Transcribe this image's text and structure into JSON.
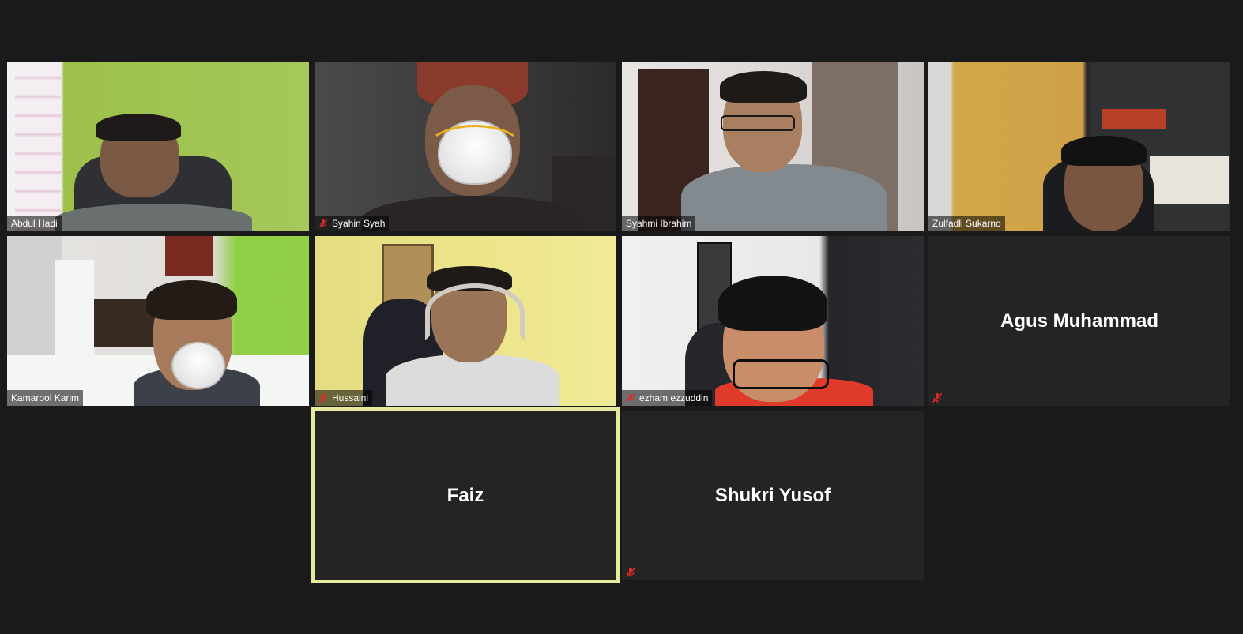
{
  "participants": [
    {
      "name": "Abdul Hadi",
      "muted": false,
      "video": true
    },
    {
      "name": "Syahin Syah",
      "muted": true,
      "video": true
    },
    {
      "name": "Syahmi Ibrahim",
      "muted": false,
      "video": true
    },
    {
      "name": "Zulfadli Sukarno",
      "muted": false,
      "video": true
    },
    {
      "name": "Kamarool Karim",
      "muted": false,
      "video": true
    },
    {
      "name": "Hussaini",
      "muted": true,
      "video": true
    },
    {
      "name": "ezham ezzuddin",
      "muted": true,
      "video": true
    },
    {
      "name": "Agus Muhammad",
      "muted": true,
      "video": false
    },
    {
      "name": "Faiz",
      "muted": false,
      "video": false,
      "active_speaker": true
    },
    {
      "name": "Shukri Yusof",
      "muted": true,
      "video": false
    }
  ],
  "colors": {
    "background": "#1a1a1a",
    "tile": "#242424",
    "active_speaker_border": "#e5ea9c",
    "mute_icon": "#e02828"
  },
  "icons": {
    "mute": "microphone-muted-icon"
  }
}
